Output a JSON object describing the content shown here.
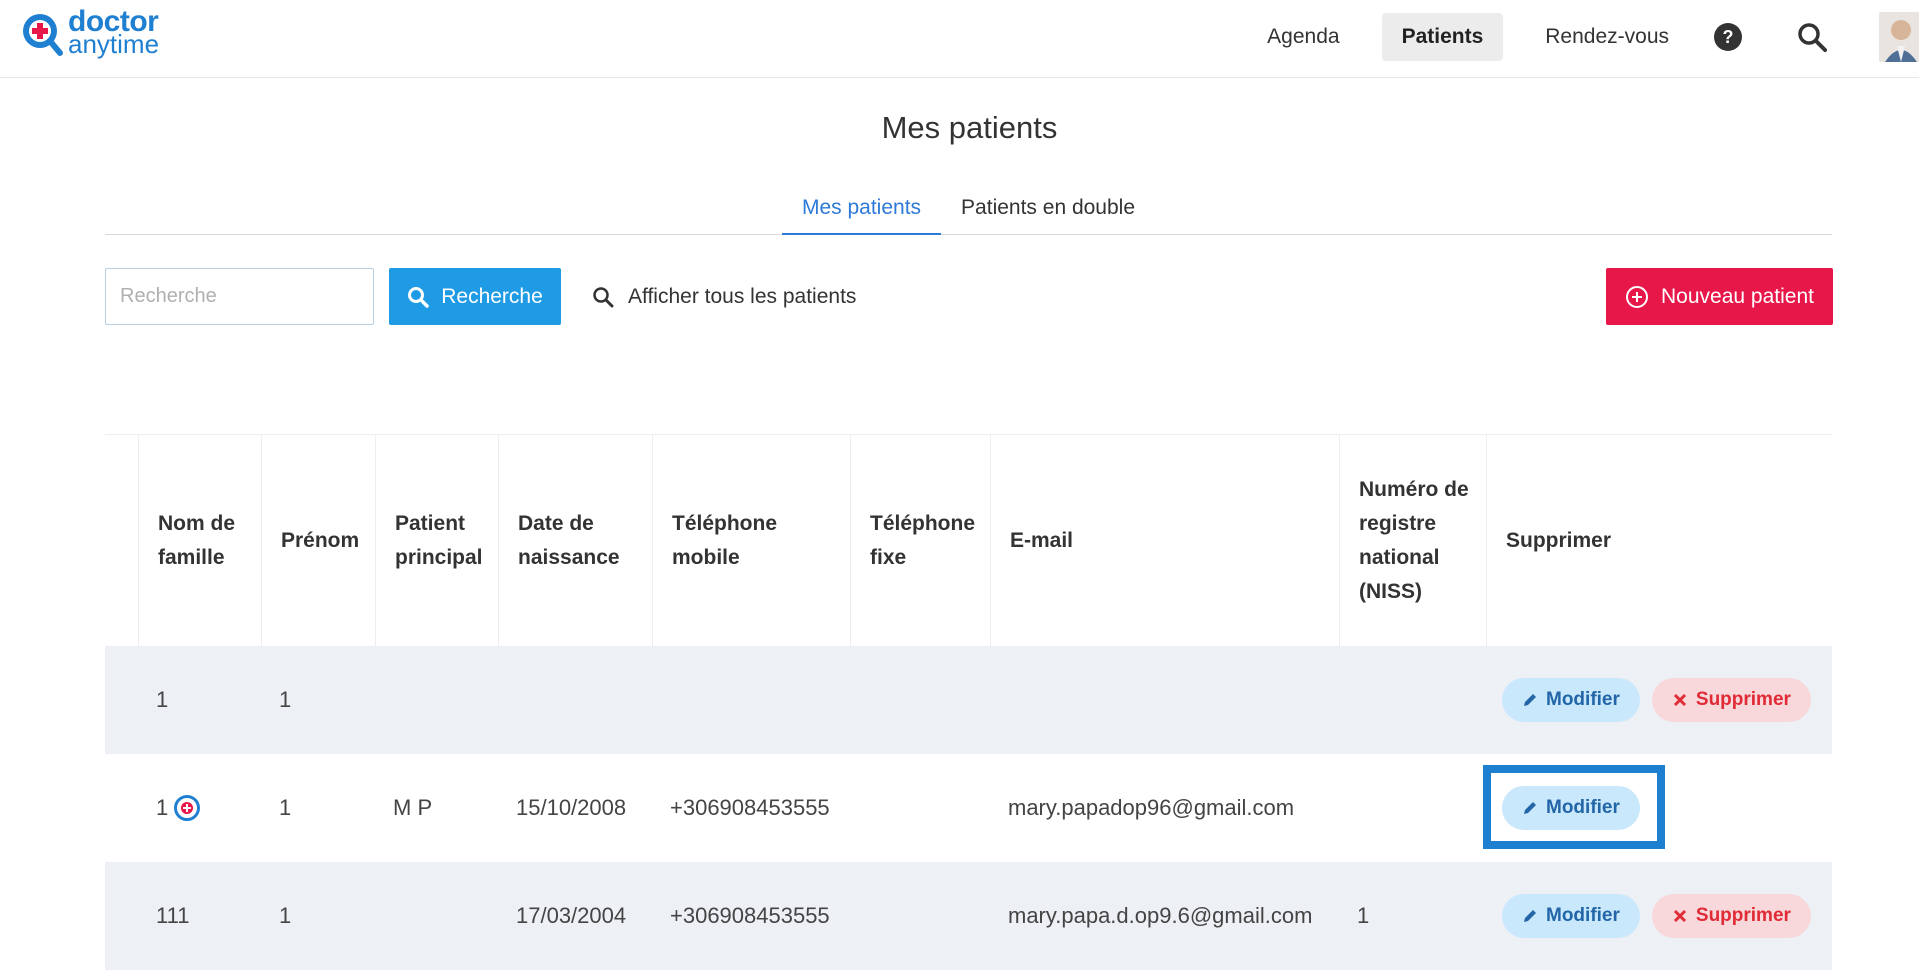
{
  "brand": {
    "line1": "doctor",
    "line2": "anytime",
    "colors": {
      "primary": "#1f7fd1",
      "red": "#e8174a"
    }
  },
  "nav": {
    "items": [
      {
        "label": "Agenda",
        "active": false
      },
      {
        "label": "Patients",
        "active": true
      },
      {
        "label": "Rendez-vous",
        "active": false
      }
    ],
    "icons": [
      "help-icon",
      "search-icon",
      "avatar"
    ]
  },
  "page": {
    "title": "Mes patients"
  },
  "tabs": [
    {
      "label": "Mes patients",
      "active": true
    },
    {
      "label": "Patients en double",
      "active": false
    }
  ],
  "toolbar": {
    "search_placeholder": "Recherche",
    "search_value": "",
    "search_button": "Recherche",
    "show_all": "Afficher tous les patients",
    "new_patient": "Nouveau patient"
  },
  "table": {
    "headers": {
      "last_name": [
        "Nom de",
        "famille"
      ],
      "first_name": [
        "Prénom"
      ],
      "main_patient": [
        "Patient",
        "principal"
      ],
      "birth_date": [
        "Date de",
        "naissance"
      ],
      "mobile": [
        "Téléphone",
        "mobile"
      ],
      "landline": [
        "Téléphone",
        "fixe"
      ],
      "email": [
        "E-mail"
      ],
      "niss": [
        "Numéro de",
        "registre",
        "national",
        "(NISS)"
      ],
      "delete": [
        "Supprimer"
      ]
    },
    "rows": [
      {
        "last_name": "1",
        "first_name": "1",
        "main_patient": "",
        "birth_date": "",
        "mobile": "",
        "landline": "",
        "email": "",
        "niss": "",
        "badge": false,
        "edit": "Modifier",
        "delete": "Supprimer"
      },
      {
        "last_name": "1",
        "first_name": "1",
        "main_patient": "M P",
        "birth_date": "15/10/2008",
        "mobile": "+306908453555",
        "landline": "",
        "email": "mary.papadop96@gmail.com",
        "niss": "",
        "badge": true,
        "edit": "Modifier",
        "delete": ""
      },
      {
        "last_name": "111",
        "first_name": "1",
        "main_patient": "",
        "birth_date": "17/03/2004",
        "mobile": "+306908453555",
        "landline": "",
        "email": "mary.papa.d.op9.6@gmail.com",
        "niss": "1",
        "badge": false,
        "edit": "Modifier",
        "delete": "Supprimer"
      }
    ]
  }
}
